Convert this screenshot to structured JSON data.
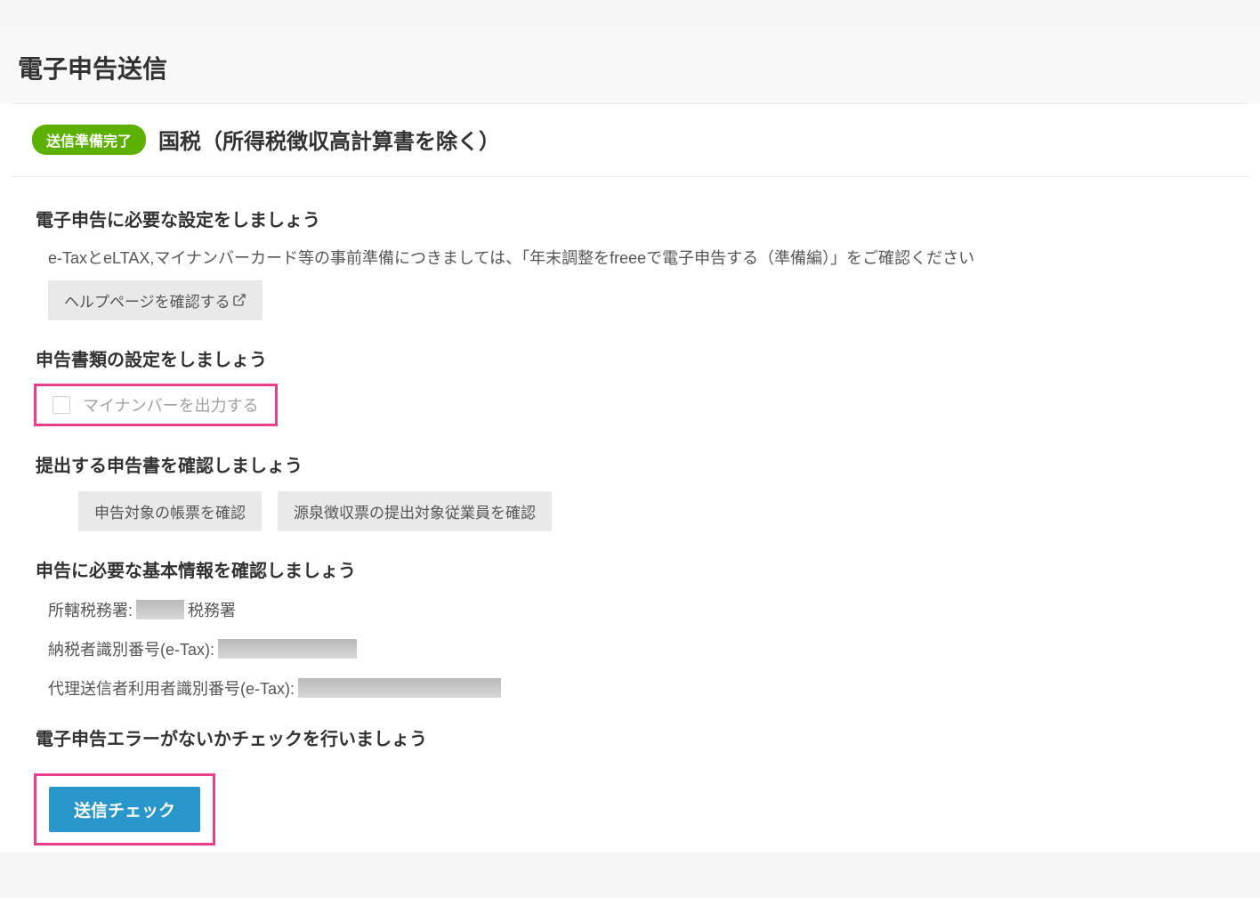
{
  "page": {
    "title": "電子申告送信"
  },
  "card": {
    "status_badge": "送信準備完了",
    "title": "国税（所得税徴収高計算書を除く）"
  },
  "sections": {
    "setup": {
      "heading": "電子申告に必要な設定をしましょう",
      "description": "e-TaxとeLTAX,マイナンバーカード等の事前準備につきましては、「年末調整をfreeeで電子申告する（準備編）」をご確認ください",
      "help_button": "ヘルプページを確認する"
    },
    "doc_settings": {
      "heading": "申告書類の設定をしましょう",
      "checkbox_label": "マイナンバーを出力する"
    },
    "confirm_docs": {
      "heading": "提出する申告書を確認しましょう",
      "button_confirm_forms": "申告対象の帳票を確認",
      "button_confirm_employees": "源泉徴収票の提出対象従業員を確認"
    },
    "basic_info": {
      "heading": "申告に必要な基本情報を確認しましょう",
      "tax_office_label": "所轄税務署:",
      "tax_office_suffix": "税務署",
      "taxpayer_id_label": "納税者識別番号(e-Tax):",
      "agent_id_label": "代理送信者利用者識別番号(e-Tax):"
    },
    "error_check": {
      "heading": "電子申告エラーがないかチェックを行いましょう",
      "button": "送信チェック"
    }
  }
}
